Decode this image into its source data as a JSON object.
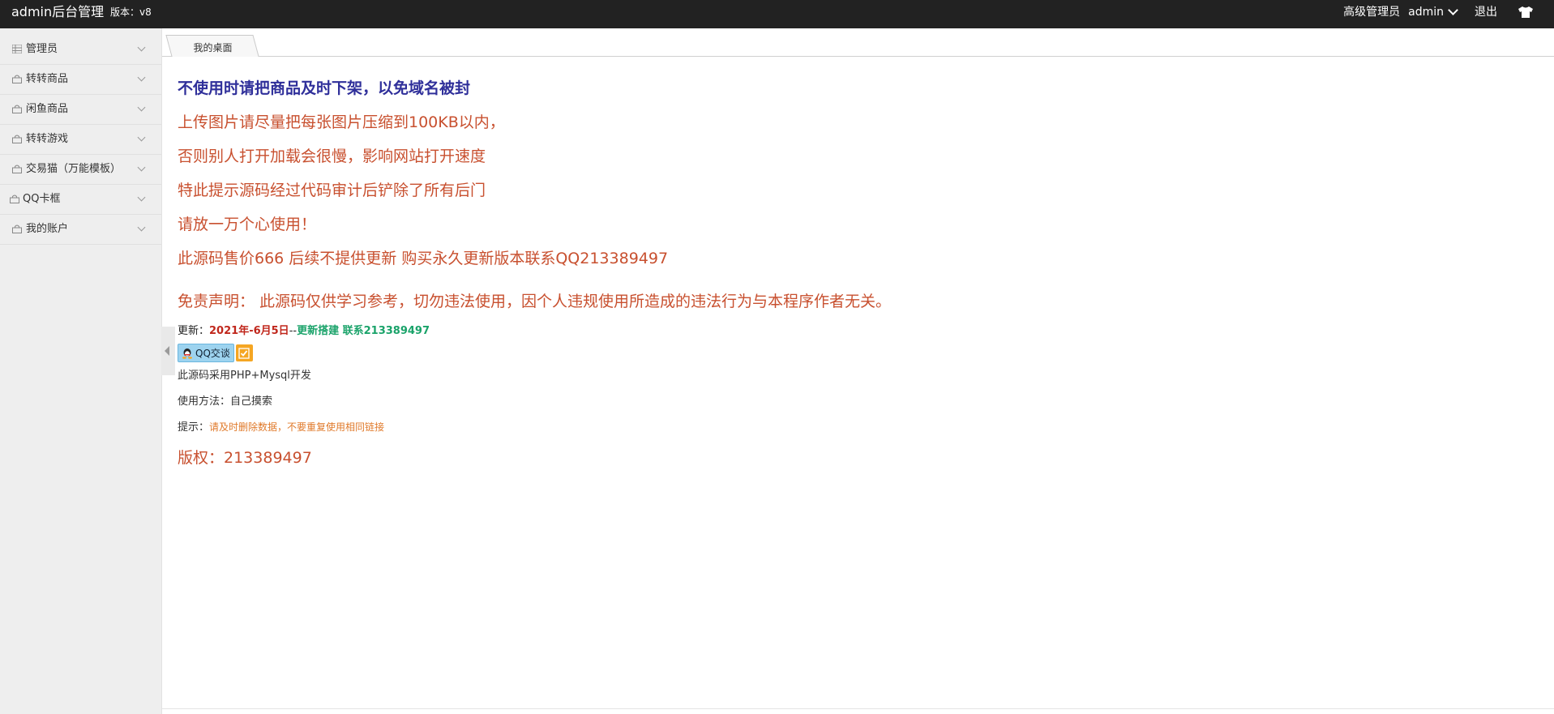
{
  "header": {
    "brand": "admin后台管理",
    "version_label": "版本：",
    "version": "v8",
    "role": "高级管理员",
    "user": "admin",
    "logout": "退出",
    "theme_icon": "shirt-icon"
  },
  "sidebar": {
    "items": [
      {
        "label": "管理员",
        "icon": "grid-icon"
      },
      {
        "label": "转转商品",
        "icon": "bag-icon"
      },
      {
        "label": "闲鱼商品",
        "icon": "bag-icon"
      },
      {
        "label": "转转游戏",
        "icon": "bag-icon"
      },
      {
        "label": "交易猫（万能模板）",
        "icon": "bag-icon"
      },
      {
        "label": "QQ卡框",
        "icon": "bag-icon"
      },
      {
        "label": "我的账户",
        "icon": "bag-icon"
      }
    ]
  },
  "tabs": [
    {
      "label": "我的桌面"
    }
  ],
  "main": {
    "notice": "不使用时请把商品及时下架，以免域名被封",
    "lines": [
      "上传图片请尽量把每张图片压缩到100KB以内，",
      "否则别人打开加载会很慢，影响网站打开速度",
      "特此提示源码经过代码审计后铲除了所有后门",
      "请放一万个心使用！",
      "此源码售价666 后续不提供更新 购买永久更新版本联系QQ213389497",
      "免责声明：  此源码仅供学习参考，切勿违法使用，因个人违规使用所造成的违法行为与本程序作者无关。"
    ],
    "update_label": "更新：",
    "update_date": "2021年-6月5日",
    "update_sep": "--",
    "update_note": "更新搭建 联系213389497",
    "qq_button": "QQ交谈",
    "tech": "此源码采用PHP+Mysql开发",
    "usage_label": "使用方法：",
    "usage_value": "自己摸索",
    "tip_label": "提示：",
    "tip_value": "请及时删除数据，不要重复使用相同链接",
    "copyright": "版权：213389497"
  },
  "colors": {
    "topbar": "#222222",
    "sidebar": "#eeeeee",
    "notice": "#2f2f9a",
    "text_red": "#c8502f",
    "date_red": "#c0271c",
    "green": "#1aa36a",
    "orange": "#e07a2b"
  }
}
